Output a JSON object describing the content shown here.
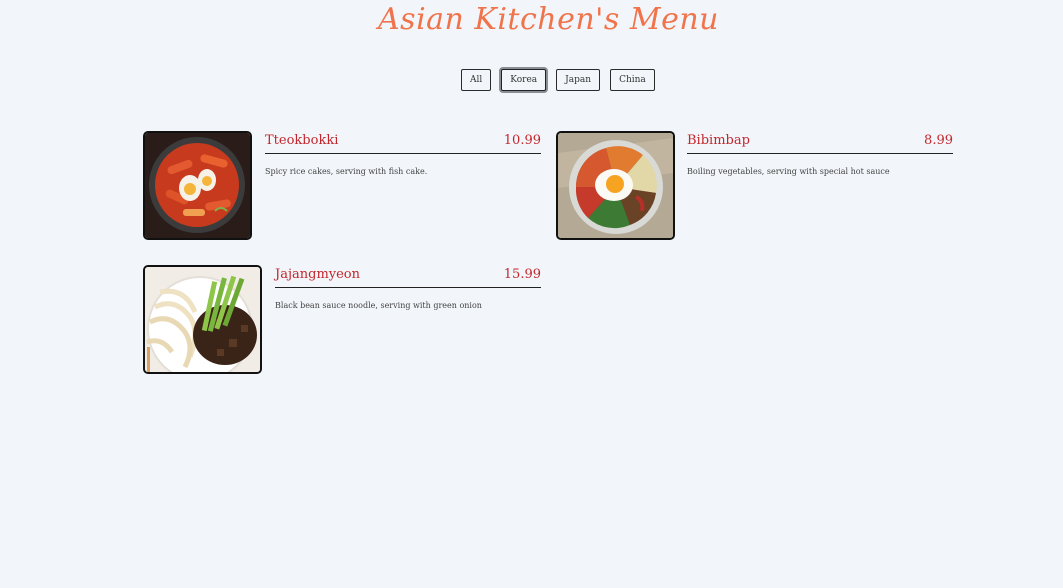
{
  "page": {
    "title": "Asian Kitchen's Menu"
  },
  "filters": [
    {
      "label": "All"
    },
    {
      "label": "Korea"
    },
    {
      "label": "Japan"
    },
    {
      "label": "China"
    }
  ],
  "active_filter": "Korea",
  "items": [
    {
      "name": "Tteokbokki",
      "price": "10.99",
      "description": "Spicy rice cakes, serving with fish cake.",
      "image": "tteokbokki-image"
    },
    {
      "name": "Bibimbap",
      "price": "8.99",
      "description": "Boiling vegetables, serving with special hot sauce",
      "image": "bibimbap-image"
    },
    {
      "name": "Jajangmyeon",
      "price": "15.99",
      "description": "Black bean sauce noodle, serving with green onion",
      "image": "jajangmyeon-image"
    }
  ],
  "colors": {
    "background": "#f2f5f9",
    "title": "#f0744b",
    "item_text": "#c2272d"
  }
}
